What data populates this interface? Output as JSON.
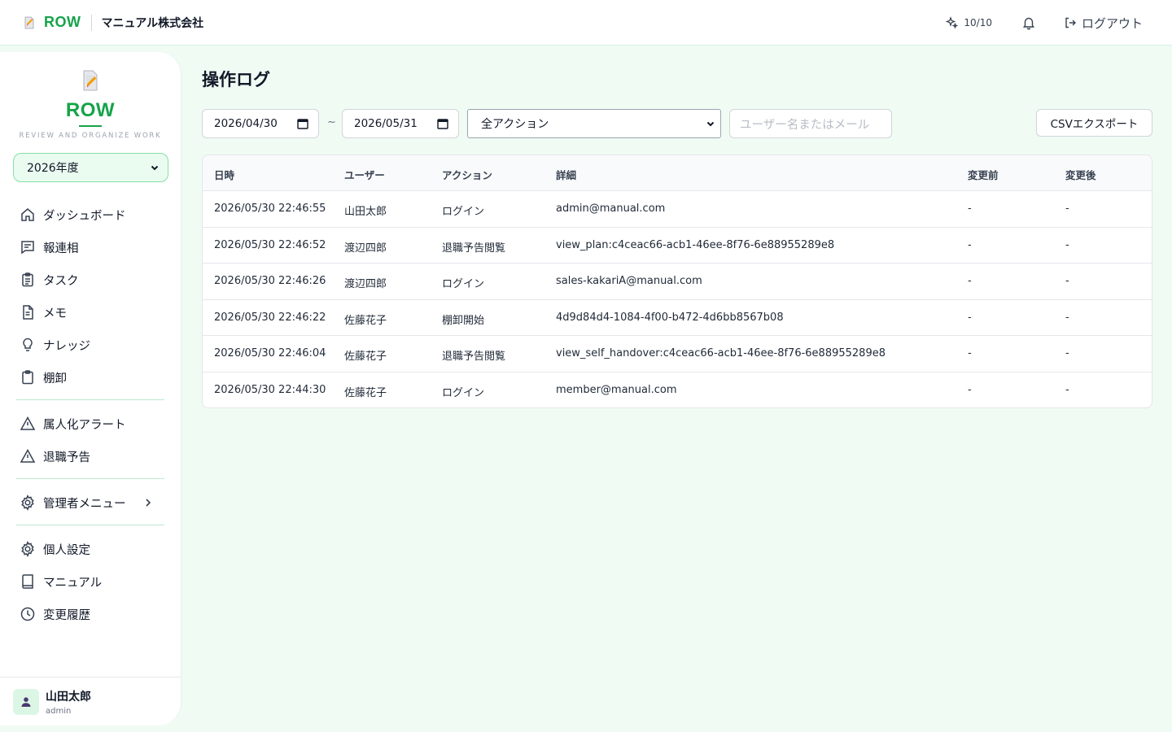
{
  "header": {
    "brand": "ROW",
    "company": "マニュアル株式会社",
    "ai_usage": "10/10",
    "logout_label": "ログアウト"
  },
  "sidebar": {
    "logo_name": "ROW",
    "tagline": "REVIEW AND ORGANIZE WORK",
    "year_selected": "2026年度",
    "items": [
      {
        "label": "ダッシュボード",
        "icon": "home-icon"
      },
      {
        "label": "報連相",
        "icon": "message-icon"
      },
      {
        "label": "タスク",
        "icon": "clipboard-icon"
      },
      {
        "label": "メモ",
        "icon": "document-icon"
      },
      {
        "label": "ナレッジ",
        "icon": "lightbulb-icon"
      },
      {
        "label": "棚卸",
        "icon": "clipboard-blank-icon"
      },
      {
        "label": "属人化アラート",
        "icon": "warning-icon"
      },
      {
        "label": "退職予告",
        "icon": "warning-icon"
      },
      {
        "label": "管理者メニュー",
        "icon": "gear-icon"
      },
      {
        "label": "個人設定",
        "icon": "gear-icon"
      },
      {
        "label": "マニュアル",
        "icon": "book-icon"
      },
      {
        "label": "変更履歴",
        "icon": "clock-icon"
      }
    ],
    "user": {
      "name": "山田太郎",
      "role": "admin"
    }
  },
  "main": {
    "title": "操作ログ",
    "filters": {
      "date_from": "2026/04/30",
      "separator": "~",
      "date_to": "2026/05/31",
      "action_selected": "全アクション",
      "search_placeholder": "ユーザー名またはメール",
      "export_label": "CSVエクスポート"
    },
    "table": {
      "columns": [
        "日時",
        "ユーザー",
        "アクション",
        "詳細",
        "変更前",
        "変更後"
      ],
      "rows": [
        [
          "2026/05/30 22:46:55",
          "山田太郎",
          "ログイン",
          "admin@manual.com",
          "-",
          "-"
        ],
        [
          "2026/05/30 22:46:52",
          "渡辺四郎",
          "退職予告閲覧",
          "view_plan:c4ceac66-acb1-46ee-8f76-6e88955289e8",
          "-",
          "-"
        ],
        [
          "2026/05/30 22:46:26",
          "渡辺四郎",
          "ログイン",
          "sales-kakariA@manual.com",
          "-",
          "-"
        ],
        [
          "2026/05/30 22:46:22",
          "佐藤花子",
          "棚卸開始",
          "4d9d84d4-1084-4f00-b472-4d6bb8567b08",
          "-",
          "-"
        ],
        [
          "2026/05/30 22:46:04",
          "佐藤花子",
          "退職予告閲覧",
          "view_self_handover:c4ceac66-acb1-46ee-8f76-6e88955289e8",
          "-",
          "-"
        ],
        [
          "2026/05/30 22:44:30",
          "佐藤花子",
          "ログイン",
          "member@manual.com",
          "-",
          "-"
        ]
      ]
    }
  },
  "colors": {
    "brand": "#16a34a",
    "background": "#f0fbf4"
  }
}
